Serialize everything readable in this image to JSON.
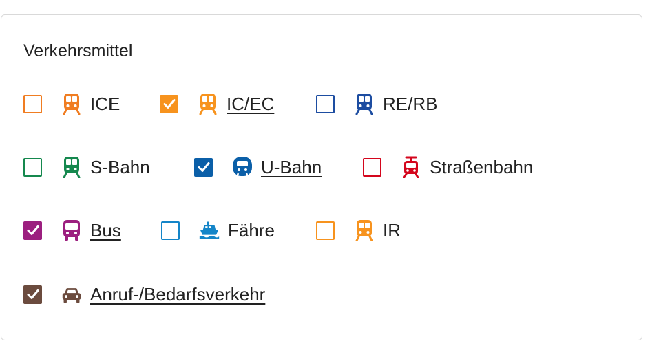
{
  "title": "Verkehrsmittel",
  "options": [
    {
      "label": "ICE",
      "color": "#f07d22",
      "checked": false,
      "icon": "train-icon"
    },
    {
      "label": "IC/EC",
      "color": "#f7931e",
      "checked": true,
      "icon": "train-icon"
    },
    {
      "label": "RE/RB",
      "color": "#1d4da1",
      "checked": false,
      "icon": "train-icon"
    },
    {
      "label": "S-Bahn",
      "color": "#15884e",
      "checked": false,
      "icon": "train-icon"
    },
    {
      "label": "U-Bahn",
      "color": "#0b5fa8",
      "checked": true,
      "icon": "subway-icon"
    },
    {
      "label": "Straßenbahn",
      "color": "#d4061d",
      "checked": false,
      "icon": "tram-icon"
    },
    {
      "label": "Bus",
      "color": "#9c1f7f",
      "checked": true,
      "icon": "bus-icon"
    },
    {
      "label": "Fähre",
      "color": "#1485c8",
      "checked": false,
      "icon": "ferry-icon"
    },
    {
      "label": "IR",
      "color": "#f7931e",
      "checked": false,
      "icon": "train-icon"
    },
    {
      "label": "Anruf-/Bedarfsverkehr",
      "color": "#6b4b3e",
      "checked": true,
      "icon": "car-icon"
    }
  ]
}
